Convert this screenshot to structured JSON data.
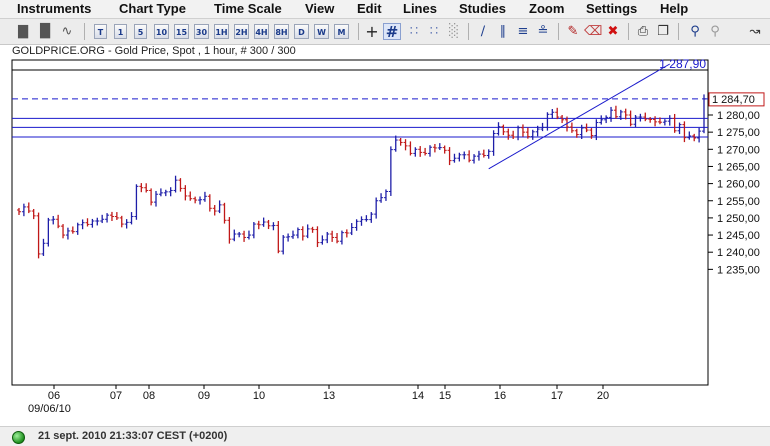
{
  "menu": [
    "Instruments",
    "Chart Type",
    "Time Scale",
    "View",
    "Edit",
    "Lines",
    "Studies",
    "Zoom",
    "Settings",
    "Help"
  ],
  "toolbar": {
    "timeframes": [
      "T",
      "1",
      "5",
      "10",
      "15",
      "30",
      "1H",
      "2H",
      "4H",
      "8H",
      "D",
      "W",
      "M"
    ],
    "icons": [
      "candlestick-icon",
      "bar-chart-icon",
      "line-chart-icon",
      "crosshair-icon",
      "grid-icon",
      "dotted-grid-icon",
      "volume-icon",
      "trendline-icon",
      "parallel-lines-icon",
      "fibonacci-icon",
      "channel-icon",
      "pencil-icon",
      "eraser-icon",
      "delete-icon",
      "print-icon",
      "copy-icon",
      "zoom-in-icon",
      "zoom-out-icon",
      "tools-icon"
    ]
  },
  "chart_title": "GOLDPRICE.ORG - Gold Price, Spot , 1 hour, # 300 / 300",
  "status_text": "21 sept. 2010 21:33:07  CEST (+0200)",
  "chart_data": {
    "type": "ohlc",
    "title": "GOLDPRICE.ORG - Gold Price, Spot , 1 hour, # 300 / 300",
    "ylim": [
      1235,
      1290
    ],
    "y_ticks": [
      "1 280,00",
      "1 275,00",
      "1 270,00",
      "1 265,00",
      "1 260,00",
      "1 255,00",
      "1 250,00",
      "1 245,00",
      "1 240,00",
      "1 235,00"
    ],
    "x_ticks": [
      "06",
      "07",
      "08",
      "09",
      "10",
      "13",
      "14",
      "15",
      "16",
      "17",
      "20"
    ],
    "x_sublabel": "09/06/10",
    "high_label": "1 287,90",
    "last_price_label": "1 284,70",
    "last_price": 1284.7,
    "colors": {
      "up": "#1e1ea8",
      "down": "#c01818",
      "grid_line": "#1a1acc",
      "frame": "#000000"
    },
    "horizontal_lines": [
      1279.0,
      1276.4,
      1273.6
    ],
    "trendline": {
      "from": {
        "x_index": 96,
        "y": 1264.3
      },
      "to": {
        "x_index": 133,
        "y": 1287.9
      }
    },
    "closes": [
      1251.8,
      1253.2,
      1252.0,
      1250.6,
      1239.5,
      1242.6,
      1249.4,
      1249.6,
      1247.6,
      1245.0,
      1246.2,
      1246.0,
      1248.0,
      1248.6,
      1248.1,
      1249.1,
      1249.1,
      1249.6,
      1250.8,
      1250.4,
      1250.0,
      1248.2,
      1248.7,
      1250.4,
      1259.2,
      1258.8,
      1258.0,
      1254.6,
      1256.9,
      1257.3,
      1257.6,
      1258.0,
      1261.0,
      1258.6,
      1256.4,
      1255.6,
      1255.2,
      1255.3,
      1256.3,
      1252.8,
      1252.0,
      1253.8,
      1249.3,
      1243.8,
      1245.3,
      1245.3,
      1244.3,
      1245.0,
      1248.2,
      1248.0,
      1248.8,
      1247.7,
      1247.8,
      1240.3,
      1244.4,
      1244.5,
      1245.0,
      1246.6,
      1244.7,
      1246.8,
      1246.6,
      1242.8,
      1243.6,
      1245.3,
      1244.3,
      1243.2,
      1245.7,
      1245.6,
      1247.2,
      1249.0,
      1249.5,
      1249.5,
      1251.1,
      1255.0,
      1255.9,
      1257.7,
      1269.9,
      1272.7,
      1272.0,
      1271.0,
      1268.8,
      1270.0,
      1269.1,
      1268.8,
      1270.6,
      1270.4,
      1270.5,
      1269.7,
      1266.7,
      1267.4,
      1268.4,
      1268.4,
      1266.8,
      1268.0,
      1268.6,
      1268.2,
      1269.4,
      1274.6,
      1276.6,
      1275.1,
      1274.1,
      1273.6,
      1276.3,
      1275.0,
      1273.7,
      1275.1,
      1275.9,
      1276.4,
      1280.2,
      1280.8,
      1279.4,
      1278.6,
      1276.5,
      1275.4,
      1274.3,
      1276.2,
      1275.6,
      1274.0,
      1277.8,
      1278.6,
      1279.3,
      1281.4,
      1279.5,
      1280.9,
      1280.0,
      1277.3,
      1279.4,
      1279.4,
      1278.8,
      1278.7,
      1278.0,
      1277.9,
      1278.2,
      1279.0,
      1275.4,
      1277.2,
      1273.4,
      1273.9,
      1273.3,
      1275.3,
      1284.7
    ]
  }
}
